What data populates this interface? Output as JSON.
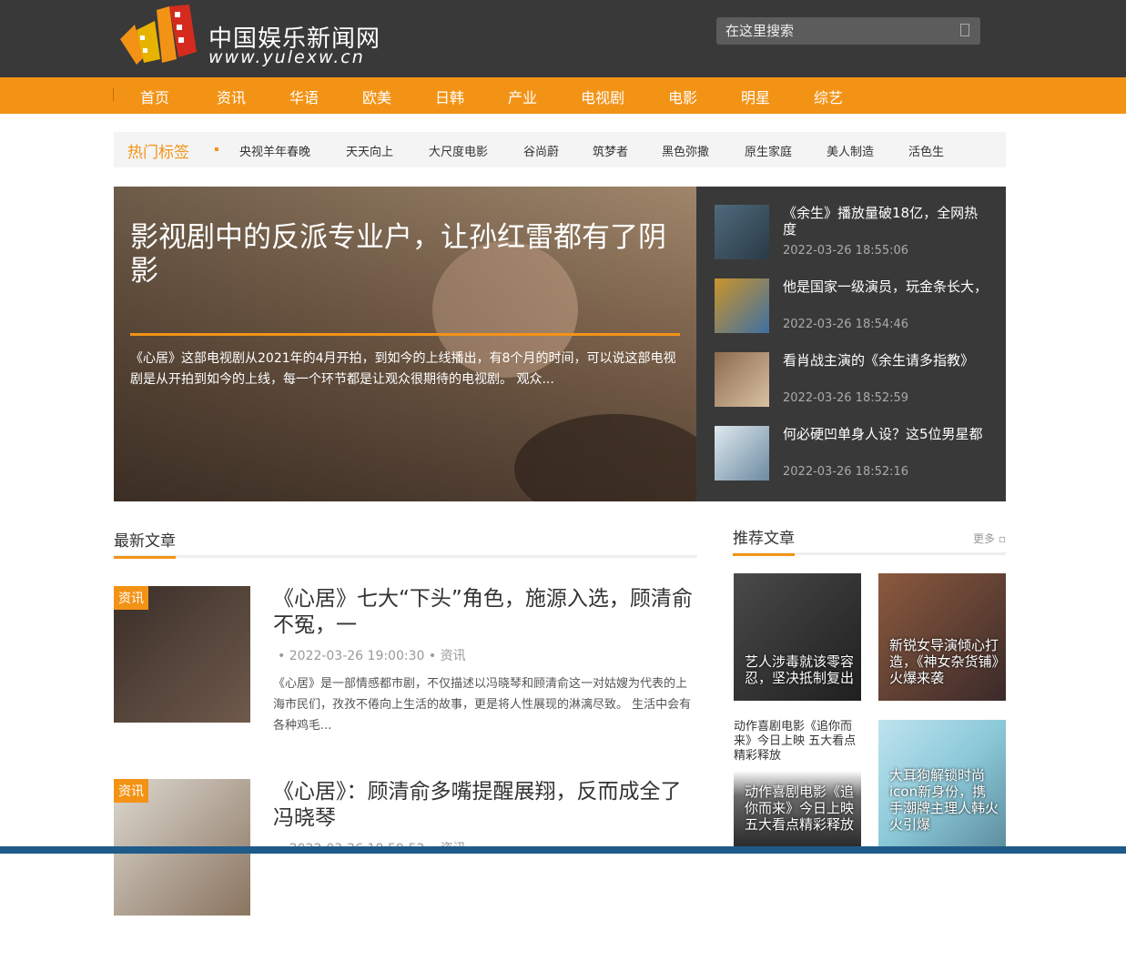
{
  "site": {
    "logo_cn": "中国娱乐新闻网",
    "logo_url": "www.yulexw.cn"
  },
  "search": {
    "placeholder": "在这里搜索"
  },
  "nav": [
    "首页",
    "资讯",
    "华语",
    "欧美",
    "日韩",
    "产业",
    "电视剧",
    "电影",
    "明星",
    "综艺"
  ],
  "tags": {
    "title": "热门标签",
    "items": [
      "央视羊年春晚",
      "天天向上",
      "大尺度电影",
      "谷尚蔚",
      "筑梦者",
      "黑色弥撒",
      "原生家庭",
      "美人制造",
      "活色生"
    ]
  },
  "hero": {
    "title": "影视剧中的反派专业户，让孙红雷都有了阴影",
    "desc": "《心居》这部电视剧从2021年的4月开拍，到如今的上线播出，有8个月的时间，可以说这部电视剧是从开拍到如今的上线，每一个环节都是让观众很期待的电视剧。 观众..."
  },
  "side_news": [
    {
      "title": "《余生》播放量破18亿，全网热度",
      "date": "2022-03-26 18:55:06"
    },
    {
      "title": "他是国家一级演员，玩金条长大，",
      "date": "2022-03-26 18:54:46"
    },
    {
      "title": "看肖战主演的《余生请多指教》",
      "date": "2022-03-26 18:52:59"
    },
    {
      "title": "何必硬凹单身人设？这5位男星都",
      "date": "2022-03-26 18:52:16"
    }
  ],
  "latest": {
    "heading": "最新文章",
    "articles": [
      {
        "badge": "资讯",
        "title": "《心居》七大“下头”角色，施源入选，顾清俞不冤，一",
        "date": "2022-03-26 19:00:30",
        "category": "资讯",
        "desc": "《心居》是一部情感都市剧，不仅描述以冯晓琴和顾清俞这一对姑嫂为代表的上海市民们，孜孜不倦向上生活的故事，更是将人性展现的淋漓尽致。 生活中会有各种鸡毛..."
      },
      {
        "badge": "资讯",
        "title": "《心居》：顾清俞多嘴提醒展翔，反而成全了冯晓琴",
        "date": "2022-03-26 18:59:52",
        "category": "资讯",
        "desc": ""
      }
    ]
  },
  "recommend": {
    "heading": "推荐文章",
    "more": "更多",
    "cards": [
      {
        "caption": "艺人涉毒就该零容忍，坚决抵制复出",
        "alt": ""
      },
      {
        "caption": "新锐女导演倾心打造，《神女杂货铺》火爆来袭",
        "alt": ""
      },
      {
        "caption": "动作喜剧电影《追你而来》今日上映 五大看点精彩释放",
        "alt": "动作喜剧电影《追你而来》今日上映 五大看点精彩释放"
      },
      {
        "caption": "大耳狗解锁时尚icon新身份，携手潮牌主理人韩火火引爆",
        "alt": ""
      }
    ]
  },
  "colors": {
    "accent": "#f39316",
    "header_bg": "#393939"
  }
}
